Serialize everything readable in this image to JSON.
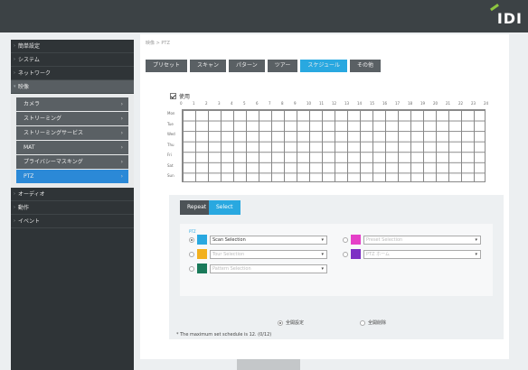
{
  "header": {
    "logo": "IDI"
  },
  "sidebar": {
    "items": [
      {
        "label": "簡単設定"
      },
      {
        "label": "システム"
      },
      {
        "label": "ネットワーク"
      },
      {
        "label": "映像"
      }
    ],
    "subitems": [
      {
        "label": "カメラ"
      },
      {
        "label": "ストリーミング"
      },
      {
        "label": "ストリーミングサービス"
      },
      {
        "label": "MAT"
      },
      {
        "label": "プライバシーマスキング"
      },
      {
        "label": "PTZ"
      }
    ],
    "bottom_items": [
      {
        "label": "オーディオ"
      },
      {
        "label": "動作"
      },
      {
        "label": "イベント"
      }
    ]
  },
  "main": {
    "breadcrumb": "映像 > PTZ",
    "tabs": [
      {
        "label": "プリセット"
      },
      {
        "label": "スキャン"
      },
      {
        "label": "パターン"
      },
      {
        "label": "ツアー"
      },
      {
        "label": "スケジュール"
      },
      {
        "label": "その他"
      }
    ],
    "use_label": "使用",
    "hours": [
      "0",
      "1",
      "2",
      "3",
      "4",
      "5",
      "6",
      "7",
      "8",
      "9",
      "10",
      "11",
      "12",
      "13",
      "14",
      "15",
      "16",
      "17",
      "18",
      "19",
      "20",
      "21",
      "22",
      "23",
      "24"
    ],
    "days": [
      "Mon",
      "Tue",
      "Wed",
      "Thu",
      "Fri",
      "Sat",
      "Sun"
    ],
    "modes": {
      "repeat": "Repeat",
      "select": "Select"
    },
    "mode_label": "PTZ",
    "schedules": [
      {
        "color": "#29a8e0",
        "value": "Scan Selection"
      },
      {
        "color": "#f2b01e",
        "value": "Tour Selection"
      },
      {
        "color": "#1a7a5a",
        "value": "Pattern Selection"
      },
      {
        "color": "#e540c8",
        "value": "Preset Selection"
      },
      {
        "color": "#7d2fc4",
        "value": "PTZ ホーム"
      }
    ],
    "footer": {
      "option1": "全開設定",
      "option2": "全開削除",
      "note": "* The maximum set schedule is 12. (0/12)"
    }
  },
  "colors": {
    "accent": "#29a8e0",
    "sidebar_selected": "#2b89d7"
  }
}
